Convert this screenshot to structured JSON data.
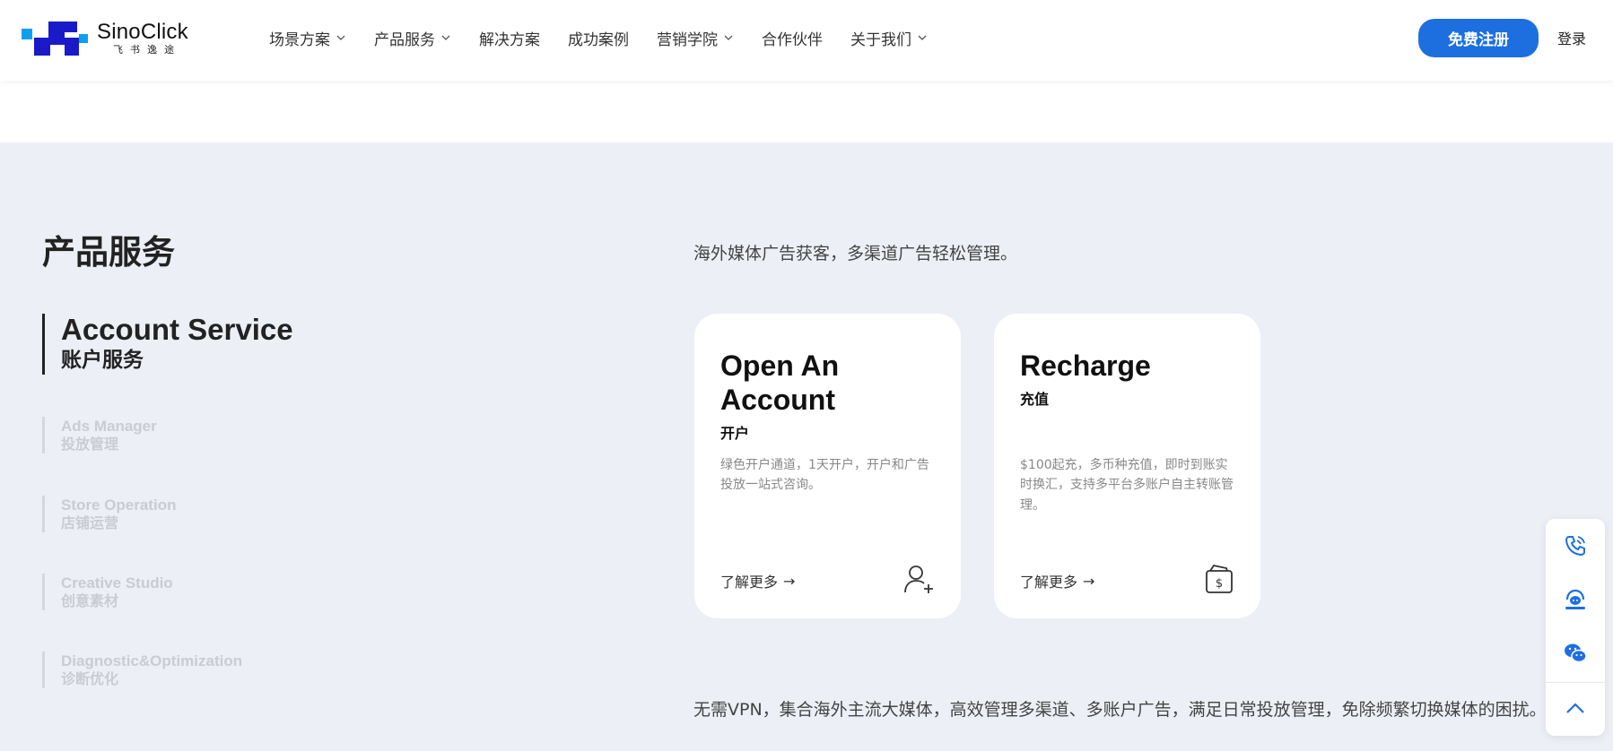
{
  "header": {
    "logo": {
      "name": "SinoClick",
      "sub": "飞书逸途"
    },
    "nav": [
      {
        "label": "场景方案",
        "dropdown": true
      },
      {
        "label": "产品服务",
        "dropdown": true
      },
      {
        "label": "解决方案",
        "dropdown": false
      },
      {
        "label": "成功案例",
        "dropdown": false
      },
      {
        "label": "营销学院",
        "dropdown": true
      },
      {
        "label": "合作伙伴",
        "dropdown": false
      },
      {
        "label": "关于我们",
        "dropdown": true
      }
    ],
    "register_label": "免费注册",
    "login_label": "登录"
  },
  "section": {
    "title": "产品服务",
    "subtitle": "海外媒体广告获客，多渠道广告轻松管理。",
    "tabs": [
      {
        "en": "Account Service",
        "zh": "账户服务",
        "active": true
      },
      {
        "en": "Ads Manager",
        "zh": "投放管理",
        "active": false
      },
      {
        "en": "Store Operation",
        "zh": "店铺运营",
        "active": false
      },
      {
        "en": "Creative Studio",
        "zh": "创意素材",
        "active": false
      },
      {
        "en": "Diagnostic&Optimization",
        "zh": "诊断优化",
        "active": false
      }
    ],
    "cards": [
      {
        "title": "Open An Account",
        "subtitle": "开户",
        "desc": "绿色开户通道，1天开户，开户和广告投放一站式咨询。",
        "more": "了解更多",
        "icon": "add-user-icon"
      },
      {
        "title": "Recharge",
        "subtitle": "充值",
        "desc": "$100起充，多币种充值，即时到账实时换汇，支持多平台多账户自主转账管理。",
        "more": "了解更多",
        "icon": "wallet-icon"
      }
    ],
    "bottom_text": "无需VPN，集合海外主流大媒体，高效管理多渠道、多账户广告，满足日常投放管理，免除频繁切换媒体的困扰。"
  },
  "float_bar": [
    "phone-icon",
    "customer-service-icon",
    "wechat-icon",
    "back-to-top-icon"
  ],
  "colors": {
    "brand": "#1d6fe0",
    "logo_blue": "#1a1ac8",
    "logo_cyan": "#0aa0f0",
    "background": "#eceff6"
  }
}
